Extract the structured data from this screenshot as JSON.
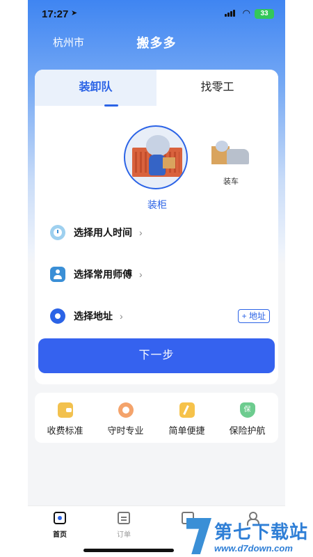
{
  "status_bar": {
    "time": "17:27",
    "battery": "33"
  },
  "header": {
    "city": "杭州市",
    "title": "搬多多"
  },
  "tabs": [
    {
      "label": "装卸队"
    },
    {
      "label": "找零工"
    }
  ],
  "vehicles": [
    {
      "label": "装柜"
    },
    {
      "label": "装车"
    }
  ],
  "form_rows": [
    {
      "label": "选择用人时间"
    },
    {
      "label": "选择常用师傅"
    },
    {
      "label": "选择地址"
    }
  ],
  "add_address_label": "+ 地址",
  "next_button": "下一步",
  "features": [
    {
      "label": "收费标准",
      "icon": "wallet-icon"
    },
    {
      "label": "守时专业",
      "icon": "alarm-clock-icon"
    },
    {
      "label": "简单便捷",
      "icon": "flag-icon"
    },
    {
      "label": "保险护航",
      "icon": "shield-icon"
    }
  ],
  "shield_glyph": "保",
  "bottom_nav": [
    {
      "label": "首页",
      "icon": "home-icon"
    },
    {
      "label": "订单",
      "icon": "order-icon"
    }
  ],
  "watermark": {
    "title": "第七下载站",
    "url": "www.d7down.com"
  },
  "colors": {
    "accent": "#3562ef",
    "tab_active": "#2b63e6"
  }
}
